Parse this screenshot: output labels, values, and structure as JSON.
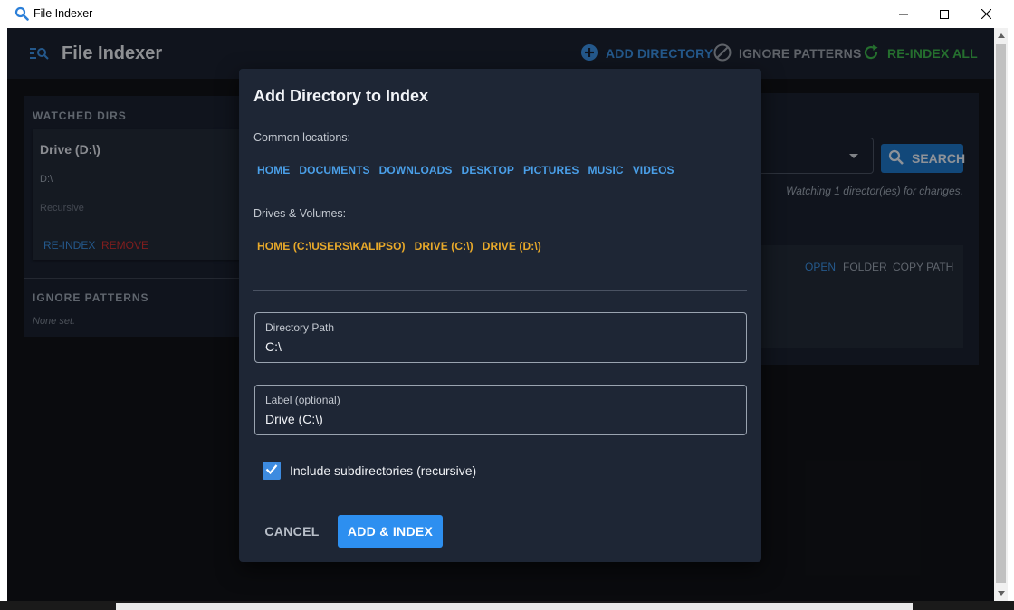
{
  "window": {
    "title": "File Indexer",
    "app_icon": "search-icon",
    "controls": [
      "minimize-icon",
      "maximize-icon",
      "close-icon"
    ]
  },
  "app": {
    "title": "File Indexer",
    "toolbar": {
      "add_directory": "ADD DIRECTORY",
      "ignore_patterns": "IGNORE PATTERNS",
      "reindex_all": "RE-INDEX ALL"
    },
    "sidebar": {
      "watched_dirs_label": "WATCHED DIRS",
      "directories": [
        {
          "name": "Drive (D:\\)",
          "path": "D:\\",
          "mode": "Recursive",
          "reindex": "RE-INDEX",
          "remove": "REMOVE"
        }
      ],
      "ignore_patterns_label": "IGNORE PATTERNS",
      "ignore_patterns_empty": "None set."
    },
    "search": {
      "button": "SEARCH",
      "watch_info": "Watching 1 director(ies) for changes."
    },
    "result": {
      "open": "OPEN",
      "folder": "FOLDER",
      "copy_path": "COPY PATH"
    }
  },
  "dialog": {
    "title": "Add Directory to Index",
    "common_label": "Common locations:",
    "common_locations": [
      "HOME",
      "DOCUMENTS",
      "DOWNLOADS",
      "DESKTOP",
      "PICTURES",
      "MUSIC",
      "VIDEOS"
    ],
    "drives_label": "Drives & Volumes:",
    "drives": [
      "HOME (C:\\USERS\\KALIPSO)",
      "DRIVE (C:\\)",
      "DRIVE (D:\\)"
    ],
    "path_field": {
      "label": "Directory Path",
      "value": "C:\\"
    },
    "label_field": {
      "label": "Label (optional)",
      "value": "Drive (C:\\)"
    },
    "recursive": {
      "label": "Include subdirectories (recursive)",
      "checked": true
    },
    "cancel": "CANCEL",
    "submit": "ADD & INDEX"
  },
  "colors": {
    "accent_blue": "#2d8ff0",
    "link_blue": "#4a9fe8",
    "drive_yellow": "#e8a92a",
    "success_green": "#3cb44b",
    "danger_red": "#d03030",
    "dialog_bg": "#1e2635"
  }
}
